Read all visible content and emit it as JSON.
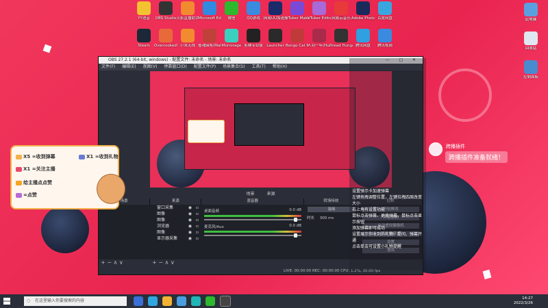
{
  "desktop_icons": {
    "row1": [
      "YY语音",
      "OBS Studio",
      "火影直播助手",
      "Microsoft Edge",
      "微信",
      "QQ游戏",
      "网易UU加速器",
      "VTuber Maker",
      "VTuber Editor",
      "网易云音乐",
      "Adobe Photoshop",
      "百度网盘"
    ],
    "row2": [
      "Steam",
      "Overcooked!",
      "小米无线",
      "雀魂麻将(Mahjong…",
      "Morrorage",
      "剪映专业版",
      "Launcher",
      "Bongo Cat Mver - Sh…",
      "人间一年(Human Fa…",
      "Dread Hunger",
      "腾讯网盘",
      "腾讯视频"
    ],
    "right": [
      "此电脑",
      "回收站",
      "控制面板"
    ]
  },
  "obs": {
    "title": "OBS 27.2.1 (64-bit, windows) - 配置文件: 未命名 - 场景: 未命名",
    "menus": [
      "文件(F)",
      "编辑(E)",
      "视图(V)",
      "停靠窗口(D)",
      "配置文件(P)",
      "场景集合(S)",
      "工具(T)",
      "帮助(H)"
    ],
    "preview_toolbar": [
      "场景",
      "来源"
    ],
    "dock_headers": [
      "场景",
      "来源",
      "混音器",
      "转场特效",
      "控制"
    ],
    "sources": [
      "窗口采集",
      "图像",
      "图像",
      "浏览器",
      "图像",
      "显示器采集"
    ],
    "mixer": [
      {
        "name": "桌面音频",
        "db": "0.0 dB"
      },
      {
        "name": "麦克风/Aux",
        "db": "0.0 dB"
      }
    ],
    "transition": {
      "type": "淡出",
      "duration_label": "时长",
      "duration_value": "300 ms"
    },
    "controls": [
      "开始推流",
      "开始录制",
      "启动虚拟摄像机",
      "工作室模式",
      "设置",
      "退出"
    ],
    "dock_footer": "+ − ∧ ∨",
    "status": "LIVE: 00:00:00   REC: 00:00:00   CPU: 1.2%, 30.00 fps"
  },
  "panel_lines": [
    "设置弹示卡加速弹幕",
    "",
    "左键拖拽调整位置，左键拉拽四周改变大小",
    "右上角有设置功能",
    "鼠标点击弹幕、更换弹幕，鼠标点击显示按钮",
    "添加弹幕即可成功",
    "",
    "设置展示你收到的礼物、提问、弹幕开通",
    "点击单击可设置小礼物提醒"
  ],
  "bubble": {
    "name": "跨播插件",
    "message": "跨播插件准备就绪！"
  },
  "hint_card": [
    {
      "text": "X5 =收到弹幕",
      "color": "#f1b24a"
    },
    {
      "text": "X1 =收到礼物",
      "color": "#6a7bd6"
    },
    {
      "text": "X1 =关注主播",
      "color": "#e84a6a"
    },
    {
      "text": "给主播点点赞",
      "color": "#f5a623"
    },
    {
      "text": "=点赞",
      "color": "#b86ad6"
    }
  ],
  "taskbar": {
    "search_placeholder": "在这里输入你要搜索的内容",
    "time": "14:27",
    "date": "2022/3/26"
  },
  "colors": {
    "background": "#f1375c",
    "obs_bg": "#2b2e38",
    "card_border": "#f1b24a"
  }
}
